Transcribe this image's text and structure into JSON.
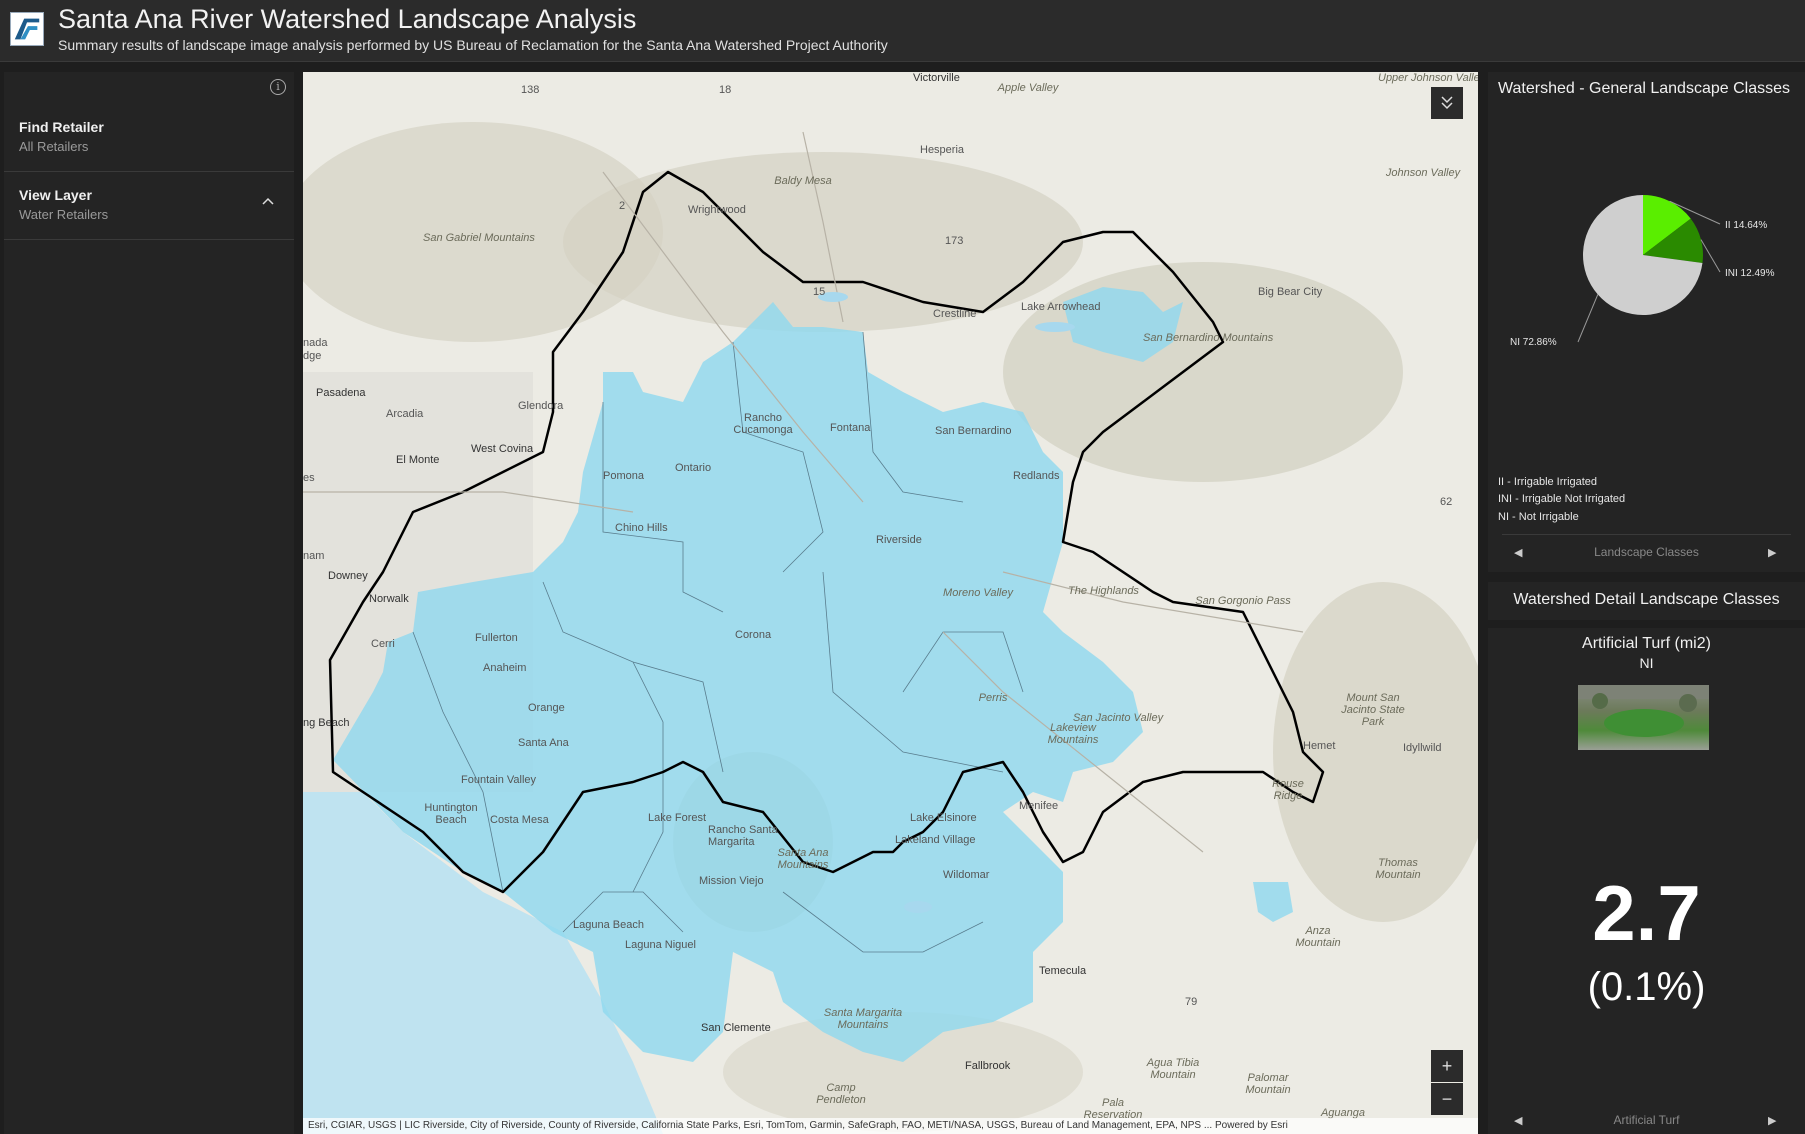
{
  "header": {
    "title": "Santa Ana River Watershed Landscape Analysis",
    "subtitle": "Summary results of landscape image analysis performed by US Bureau of Reclamation for the Santa Ana Watershed Project Authority"
  },
  "left_panel": {
    "items": [
      {
        "label": "Find Retailer",
        "value": "All Retailers"
      },
      {
        "label": "View Layer",
        "value": "Water Retailers"
      }
    ]
  },
  "map": {
    "attribution": "Esri, CGIAR, USGS | LIC Riverside, City of Riverside, County of Riverside, California State Parks, Esri, TomTom, Garmin, SafeGraph, FAO, METI/NASA, USGS, Bureau of Land Management, EPA, NPS ... Powered by Esri",
    "labels": {
      "victorville": "Victorville",
      "apple_valley": "Apple Valley",
      "hesperia": "Hesperia",
      "upper_johnson": "Upper Johnson Valley",
      "johnson_valley": "Johnson Valley",
      "baldy_mesa": "Baldy Mesa",
      "wrightwood": "Wrightwood",
      "crestline": "Crestline",
      "lake_arrowhead": "Lake Arrowhead",
      "big_bear": "Big Bear City",
      "sb_mountains": "San Bernardino Mountains",
      "sg_mountains": "San Gabriel Mountains",
      "pasadena": "Pasadena",
      "arcadia": "Arcadia",
      "glendora": "Glendora",
      "west_covina": "West Covina",
      "el_monte": "El Monte",
      "downey": "Downey",
      "norwalk": "Norwalk",
      "pomona": "Pomona",
      "ontario": "Ontario",
      "rancho": "Rancho Cucamonga",
      "fontana": "Fontana",
      "san_bernardino": "San Bernardino",
      "redlands": "Redlands",
      "riverside": "Riverside",
      "chino_hills": "Chino Hills",
      "corona": "Corona",
      "moreno_valley": "Moreno Valley",
      "the_highlands": "The Highlands",
      "san_gorgonio": "San Gorgonio Pass",
      "fullerton": "Fullerton",
      "anaheim": "Anaheim",
      "orange": "Orange",
      "santa_ana": "Santa Ana",
      "fountain_valley": "Fountain Valley",
      "huntington": "Huntington Beach",
      "costa_mesa": "Costa Mesa",
      "lake_forest": "Lake Forest",
      "perris": "Perris",
      "hemet": "Hemet",
      "menifee": "Menifee",
      "lake_elsinore": "Lake Elsinore",
      "lakeland": "Lakeland Village",
      "temecula": "Temecula",
      "mission_viejo": "Mission Viejo",
      "laguna_beach": "Laguna Beach",
      "laguna_niguel": "Laguna Niguel",
      "san_clemente": "San Clemente",
      "fallbrook": "Fallbrook",
      "anza": "Anza Mountain",
      "santa_ana_mtns": "Santa Ana Mountains",
      "santa_margarita": "Santa Margarita Mountains",
      "thomas_mtn": "Thomas Mountain",
      "rouse_ridge": "Rouse Ridge",
      "idyllwild": "Idyllwild",
      "lakeview_mtns": "Lakeview Mountains",
      "long_beach": "ng Beach",
      "santa_margarita_city": "Rancho Santa Margarita",
      "camp_pendleton": "Camp Pendleton",
      "wildomar": "Wildomar",
      "san_jacinto": "San Jacinto Valley",
      "mt_san_jacinto": "Mount San Jacinto State Park",
      "aguanga": "Aguanga",
      "pala": "Pala Reservation",
      "agua_tibia": "Agua Tibia Mountain",
      "palomar": "Palomar Mountain",
      "cerritos": "Cerri",
      "canada": "nada",
      "edge": "dge",
      "es": "es",
      "nam": "nam",
      "hwy_138": "138",
      "hwy_18": "18",
      "hwy_2": "2",
      "hwy_173": "173",
      "hwy_15": "15",
      "hwy_62": "62",
      "hwy_79": "79"
    }
  },
  "right_panel": {
    "general": {
      "title": "Watershed - General Landscape Classes",
      "pie_labels": {
        "ii": "II 14.64%",
        "ini": "INI 12.49%",
        "ni": "NI 72.86%"
      },
      "legend": [
        "II - Irrigable Irrigated",
        "INI - Irrigable Not Irrigated",
        "NI - Not Irrigable"
      ],
      "pager_label": "Landscape Classes",
      "colors": {
        "ii": "#5aee00",
        "ini": "#2a8a00",
        "ni": "#cfcfcf"
      }
    },
    "detail": {
      "title": "Watershed Detail Landscape Classes",
      "card_title": "Artificial Turf (mi2)",
      "card_subtitle": "NI",
      "value": "2.7",
      "percent": "(0.1%)",
      "pager_label": "Artificial Turf"
    }
  },
  "chart_data": {
    "type": "pie",
    "title": "Watershed - General Landscape Classes",
    "categories": [
      "II",
      "INI",
      "NI"
    ],
    "values": [
      14.64,
      12.49,
      72.86
    ],
    "colors": [
      "#5aee00",
      "#2a8a00",
      "#cfcfcf"
    ]
  }
}
